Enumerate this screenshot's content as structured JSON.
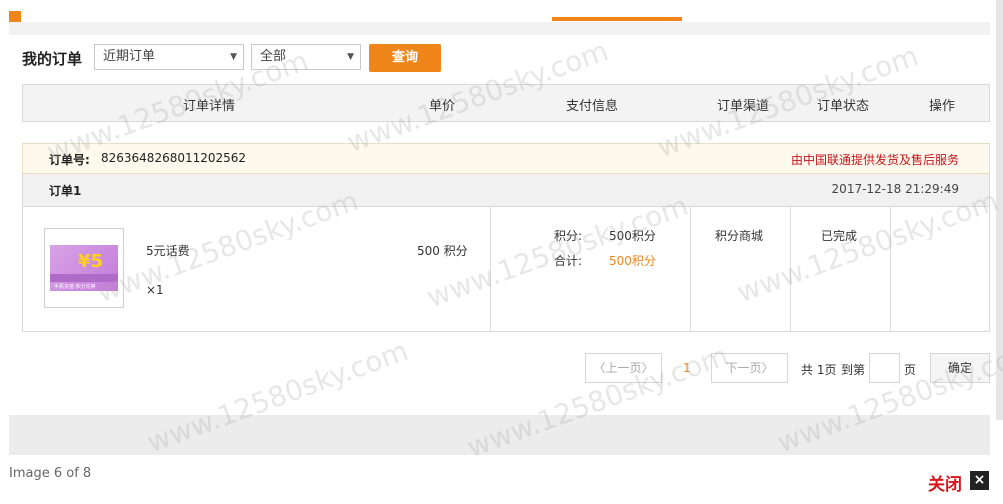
{
  "header": {
    "title": "我的订单",
    "range_select": "近期订单",
    "status_select": "全部",
    "query_button": "查询"
  },
  "table_header": [
    "订单详情",
    "单价",
    "支付信息",
    "订单渠道",
    "订单状态",
    "操作"
  ],
  "order": {
    "order_no_label": "订单号:",
    "order_no": "8263648268011202562",
    "service_text": "由中国联通提供发货及售后服务",
    "name": "订单1",
    "time": "2017-12-18 21:29:49",
    "product_name": "5元话费",
    "quantity": "×1",
    "unit_price": "500 积分",
    "pay_points_label": "积分:",
    "pay_points_value": "500积分",
    "pay_total_label": "合计:",
    "pay_total_value": "500积分",
    "channel": "积分商城",
    "status": "已完成",
    "thumb_five": "¥5",
    "thumb_caption": "手机充值  积分兑换"
  },
  "pagination": {
    "prev": "上一页",
    "current": "1",
    "next": "下一页",
    "total": "共 1页",
    "goto": "到第",
    "unit": "页",
    "confirm": "确定"
  },
  "footer": {
    "caption": "Image 6 of 8",
    "close": "关闭",
    "close_icon": "×"
  },
  "watermark": "www.12580sky.com",
  "colors": {
    "accent": "#f08519",
    "service_red": "#c4161c"
  }
}
